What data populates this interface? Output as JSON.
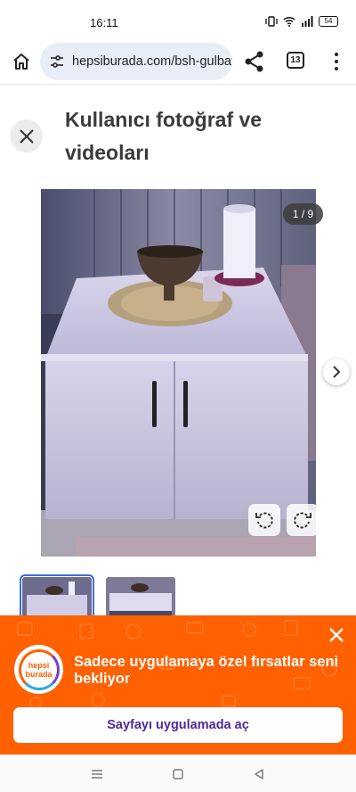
{
  "status": {
    "time": "16:11",
    "battery": "54"
  },
  "browser": {
    "url": "hepsiburada.com/bsh-gulbay",
    "tab_count": "13"
  },
  "page": {
    "title": "Kullanıcı fotoğraf ve videoları"
  },
  "gallery": {
    "counter": "1 / 9"
  },
  "promo": {
    "logo_line1": "hepsi",
    "logo_line2": "burada",
    "text": "Sadece uygulamaya özel fırsatlar seni bekliyor",
    "button_label": "Sayfayı uygulamada aç"
  },
  "colors": {
    "brand_orange": "#ff6000",
    "button_text": "#4b2a9c",
    "url_bar_bg": "#e8eef8"
  },
  "icons": [
    "home-icon",
    "site-settings-icon",
    "share-icon",
    "more-vert-icon",
    "close-icon",
    "chevron-right-icon",
    "rotate-left-icon",
    "rotate-right-icon",
    "recents-icon",
    "home-square-icon",
    "back-icon"
  ]
}
